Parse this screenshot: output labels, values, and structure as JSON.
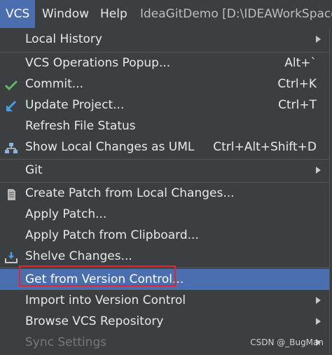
{
  "menubar": {
    "vcs": "VCS",
    "window": "Window",
    "help": "Help",
    "title": "IdeaGitDemo [D:\\IDEAWorkSpace\\"
  },
  "menu": {
    "local_history": "Local History",
    "vcs_ops_popup": "VCS Operations Popup...",
    "vcs_ops_shortcut": "Alt+`",
    "commit": "Commit...",
    "commit_shortcut": "Ctrl+K",
    "update_project": "Update Project...",
    "update_shortcut": "Ctrl+T",
    "refresh_status": "Refresh File Status",
    "show_local_changes_uml": "Show Local Changes as UML",
    "uml_shortcut": "Ctrl+Alt+Shift+D",
    "git": "Git",
    "create_patch": "Create Patch from Local Changes...",
    "apply_patch": "Apply Patch...",
    "apply_patch_clipboard": "Apply Patch from Clipboard...",
    "shelve_changes": "Shelve Changes...",
    "get_from_vc": "Get from Version Control...",
    "import_into_vc": "Import into Version Control",
    "browse_vcs_repo": "Browse VCS Repository",
    "sync_settings": "Sync Settings"
  },
  "icons": {
    "commit": "checkmark-icon",
    "update": "down-arrow-icon",
    "uml": "uml-diagram-icon",
    "patch": "patch-file-icon",
    "shelve": "shelve-icon"
  },
  "colors": {
    "background": "#3c3f41",
    "selection": "#4b6eaf",
    "highlight_border": "#e0262d",
    "commit_check": "#5fb85f",
    "update_arrow": "#4a9ee8"
  },
  "watermark": "CSDN @_BugMan"
}
